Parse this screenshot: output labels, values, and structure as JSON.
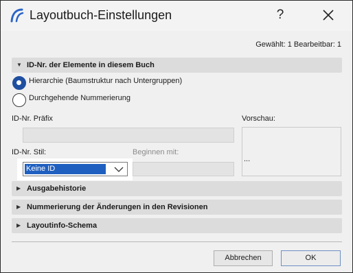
{
  "window": {
    "title": "Layoutbuch-Einstellungen",
    "help_label": "?",
    "app_icon": "archicad-arc-icon",
    "close_icon": "close-x-icon"
  },
  "selection_info": "Gewählt: 1 Bearbeitbar: 1",
  "sections": {
    "id_numbers": {
      "label": "ID-Nr. der Elemente in diesem Buch",
      "expanded": true
    },
    "output_history": {
      "label": "Ausgabehistorie",
      "expanded": false
    },
    "revision_numbering": {
      "label": "Nummerierung der Änderungen in den Revisionen",
      "expanded": false
    },
    "layout_info": {
      "label": "Layoutinfo-Schema",
      "expanded": false
    }
  },
  "numbering": {
    "hierarchy_label": "Hierarchie (Baumstruktur nach Untergruppen)",
    "hierarchy_selected": true,
    "continuous_label": "Durchgehende Nummerierung",
    "continuous_selected": false
  },
  "fields": {
    "prefix_label": "ID-Nr. Präfix",
    "prefix_value": "",
    "preview_label": "Vorschau:",
    "preview_value": "...",
    "style_label": "ID-Nr. Stil:",
    "style_value": "Keine ID",
    "start_label": "Beginnen mit:",
    "start_value": ""
  },
  "buttons": {
    "cancel": "Abbrechen",
    "ok": "OK"
  },
  "colors": {
    "accent": "#1f4fa0",
    "selection": "#1f5fbf",
    "section_bg": "#dcdcdc"
  }
}
